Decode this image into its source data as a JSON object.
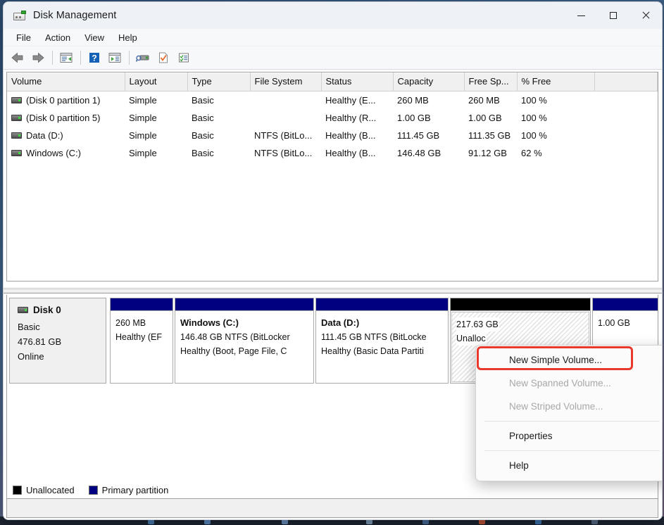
{
  "window": {
    "title": "Disk Management",
    "icon": "disk-drive-icon",
    "caption_buttons": {
      "minimize": "—",
      "maximize": "□",
      "close": "✕"
    }
  },
  "menubar": {
    "items": [
      "File",
      "Action",
      "View",
      "Help"
    ]
  },
  "toolbar": {
    "buttons": [
      {
        "name": "back-button",
        "icon": "arrow-left-icon"
      },
      {
        "name": "forward-button",
        "icon": "arrow-right-icon"
      },
      {
        "name": "show-hide-console-tree-button",
        "icon": "console-tree-icon"
      },
      {
        "name": "help-button",
        "icon": "question-mark-icon"
      },
      {
        "name": "show-action-pane-button",
        "icon": "action-pane-icon"
      },
      {
        "name": "rescan-disks-button",
        "icon": "disk-scan-icon"
      },
      {
        "name": "properties-button",
        "icon": "checkmark-document-icon"
      },
      {
        "name": "all-tasks-button",
        "icon": "task-list-icon"
      }
    ]
  },
  "volume_list": {
    "columns": [
      "Volume",
      "Layout",
      "Type",
      "File System",
      "Status",
      "Capacity",
      "Free Sp...",
      "% Free",
      ""
    ],
    "rows": [
      {
        "volume": "(Disk 0 partition 1)",
        "layout": "Simple",
        "type": "Basic",
        "file_system": "",
        "status": "Healthy (E...",
        "capacity": "260 MB",
        "free_space": "260 MB",
        "percent_free": "100 %"
      },
      {
        "volume": "(Disk 0 partition 5)",
        "layout": "Simple",
        "type": "Basic",
        "file_system": "",
        "status": "Healthy (R...",
        "capacity": "1.00 GB",
        "free_space": "1.00 GB",
        "percent_free": "100 %"
      },
      {
        "volume": "Data (D:)",
        "layout": "Simple",
        "type": "Basic",
        "file_system": "NTFS (BitLo...",
        "status": "Healthy (B...",
        "capacity": "111.45 GB",
        "free_space": "111.35 GB",
        "percent_free": "100 %"
      },
      {
        "volume": "Windows (C:)",
        "layout": "Simple",
        "type": "Basic",
        "file_system": "NTFS (BitLo...",
        "status": "Healthy (B...",
        "capacity": "146.48 GB",
        "free_space": "91.12 GB",
        "percent_free": "62 %"
      }
    ]
  },
  "disk_view": {
    "disk": {
      "name": "Disk 0",
      "type": "Basic",
      "size": "476.81 GB",
      "status": "Online"
    },
    "partitions": [
      {
        "name": "",
        "line1": "260 MB",
        "line2": "Healthy (EF",
        "kind": "primary",
        "color": "#000080"
      },
      {
        "name": "Windows  (C:)",
        "line1": "146.48 GB NTFS (BitLocker",
        "line2": "Healthy (Boot, Page File, C",
        "kind": "primary",
        "color": "#000080"
      },
      {
        "name": "Data  (D:)",
        "line1": "111.45 GB NTFS (BitLocke",
        "line2": "Healthy (Basic Data Partiti",
        "kind": "primary",
        "color": "#000080"
      },
      {
        "name": "",
        "line1": "217.63 GB",
        "line2": "Unalloc",
        "kind": "unallocated",
        "color": "#000000"
      },
      {
        "name": "",
        "line1": "1.00 GB",
        "line2": "",
        "kind": "primary",
        "color": "#000080"
      }
    ]
  },
  "legend": [
    {
      "label": "Unallocated",
      "color": "#000000"
    },
    {
      "label": "Primary partition",
      "color": "#000080"
    }
  ],
  "context_menu": {
    "items": [
      {
        "label": "New Simple Volume...",
        "enabled": true,
        "highlighted": true
      },
      {
        "label": "New Spanned Volume...",
        "enabled": false,
        "highlighted": false
      },
      {
        "label": "New Striped Volume...",
        "enabled": false,
        "highlighted": false
      },
      {
        "separator": true
      },
      {
        "label": "Properties",
        "enabled": true,
        "highlighted": false
      },
      {
        "separator": true
      },
      {
        "label": "Help",
        "enabled": true,
        "highlighted": false
      }
    ],
    "highlight_color": "#e8392c"
  }
}
